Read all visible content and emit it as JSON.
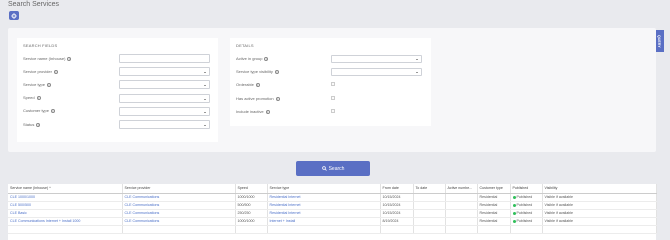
{
  "page_title": "Search Services",
  "toolbar": {
    "icon": "gear-icon"
  },
  "side_tab": {
    "label": "QUERY"
  },
  "search_fields": {
    "title": "SEARCH FIELDS",
    "fields": [
      {
        "label": "Service name (Inhouse)",
        "type": "text",
        "value": ""
      },
      {
        "label": "Service provider",
        "type": "select",
        "value": ""
      },
      {
        "label": "Service type",
        "type": "select",
        "value": ""
      },
      {
        "label": "Speed",
        "type": "select",
        "value": ""
      },
      {
        "label": "Customer type",
        "type": "select",
        "value": ""
      },
      {
        "label": "Status",
        "type": "select",
        "value": ""
      }
    ]
  },
  "details": {
    "title": "DETAILS",
    "fields": [
      {
        "label": "Active in group",
        "type": "select",
        "value": ""
      },
      {
        "label": "Service type visibility",
        "type": "select",
        "value": ""
      },
      {
        "label": "Orderable",
        "type": "checkbox",
        "value": ""
      },
      {
        "label": "Has active promotion",
        "type": "checkbox",
        "value": ""
      },
      {
        "label": "Include inactive",
        "type": "checkbox",
        "value": ""
      }
    ]
  },
  "search_button": {
    "label": "Search"
  },
  "table": {
    "columns": [
      "Service name (Inhouse)",
      "Service provider",
      "Speed",
      "Service type",
      "From date",
      "To date",
      "Active numbe...",
      "Customer type",
      "Published",
      "Visibility"
    ],
    "sort_indicator": "^",
    "rows": [
      [
        "CLE 1000/1000",
        "CLE Communications",
        "1000/1000",
        "Residential Internet",
        "10/15/2024",
        "",
        "",
        "Residential",
        "Published",
        "Visible if available"
      ],
      [
        "CLE 500/500",
        "CLE Communications",
        "500/500",
        "Residential Internet",
        "10/15/2024",
        "",
        "",
        "Residential",
        "Published",
        "Visible if available"
      ],
      [
        "CLE Basic",
        "CLE Communications",
        "250/250",
        "Residential Internet",
        "10/15/2024",
        "",
        "",
        "Residential",
        "Published",
        "Visible if available"
      ],
      [
        "CLE Communications Internet + Install 1000",
        "CLE Communications",
        "1000/1000",
        "Internet + Install",
        "8/19/2024",
        "",
        "",
        "Residential",
        "Published",
        "Visible if available"
      ],
      [
        "",
        "",
        "",
        "",
        "",
        "",
        "",
        "",
        "",
        ""
      ]
    ]
  },
  "colors": {
    "accent": "#5a6fc4",
    "link": "#4a6fc8",
    "published": "#2fbf5a"
  }
}
